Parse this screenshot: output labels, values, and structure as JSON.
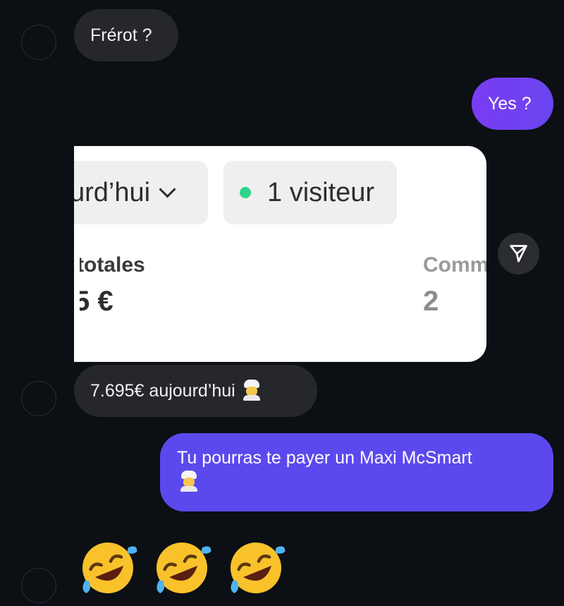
{
  "messages": {
    "m1": "Frérot ?",
    "m2": "Yes ?",
    "m3": "7.695€ aujourd’hui",
    "m4": "Tu pourras te payer un Maxi McSmart"
  },
  "screenshot": {
    "date_chip": "urd’hui",
    "visitors_chip": "1 visiteur",
    "sales_label": "totales",
    "sales_value": "5 €",
    "orders_label": "Comm",
    "orders_value": "2"
  },
  "icons": {
    "chef": "cook-emoji",
    "laugh": "rolling-on-floor-laughing-emoji",
    "share": "send-icon"
  },
  "colors": {
    "background": "#0c0f14",
    "incoming_bubble": "#25272b",
    "outgoing_bubble_1": "#7a3cf2",
    "outgoing_bubble_2": "#5b49ee",
    "visitor_dot": "#2fd48a"
  }
}
